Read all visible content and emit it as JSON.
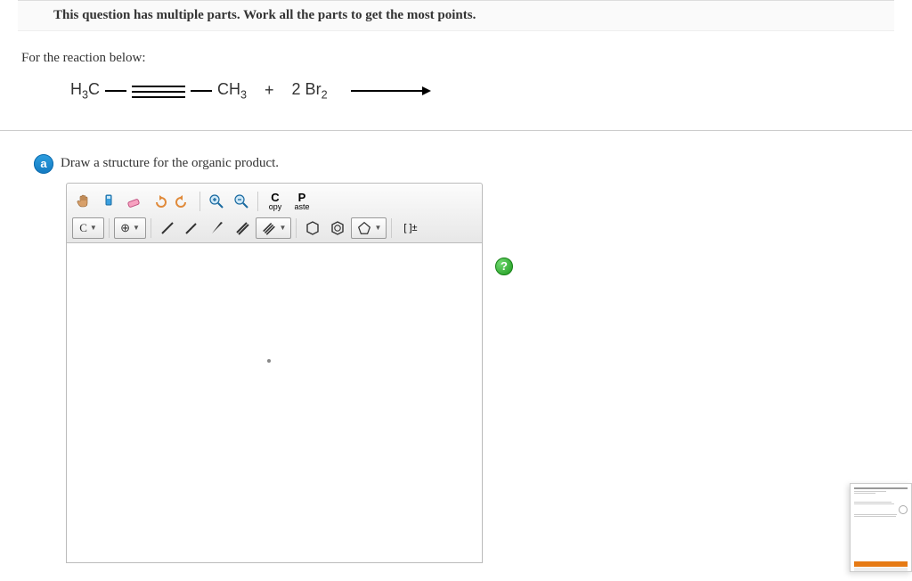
{
  "header": {
    "notice": "This question has multiple parts. Work all the parts to get the most points."
  },
  "prompt": {
    "intro": "For the reaction below:"
  },
  "reaction": {
    "left1": "H",
    "left1sub": "3",
    "left1suffix": "C",
    "right1": "CH",
    "right1sub": "3",
    "plus": "+",
    "reagent": "2 Br",
    "reagentsub": "2"
  },
  "part": {
    "label": "a",
    "text": "Draw a structure for the organic product."
  },
  "toolbar": {
    "copy_top": "C",
    "copy_bottom": "opy",
    "paste_top": "P",
    "paste_bottom": "aste",
    "atom": "C",
    "add": "⊕",
    "bracket": "[ ]±"
  },
  "help": {
    "label": "?"
  }
}
